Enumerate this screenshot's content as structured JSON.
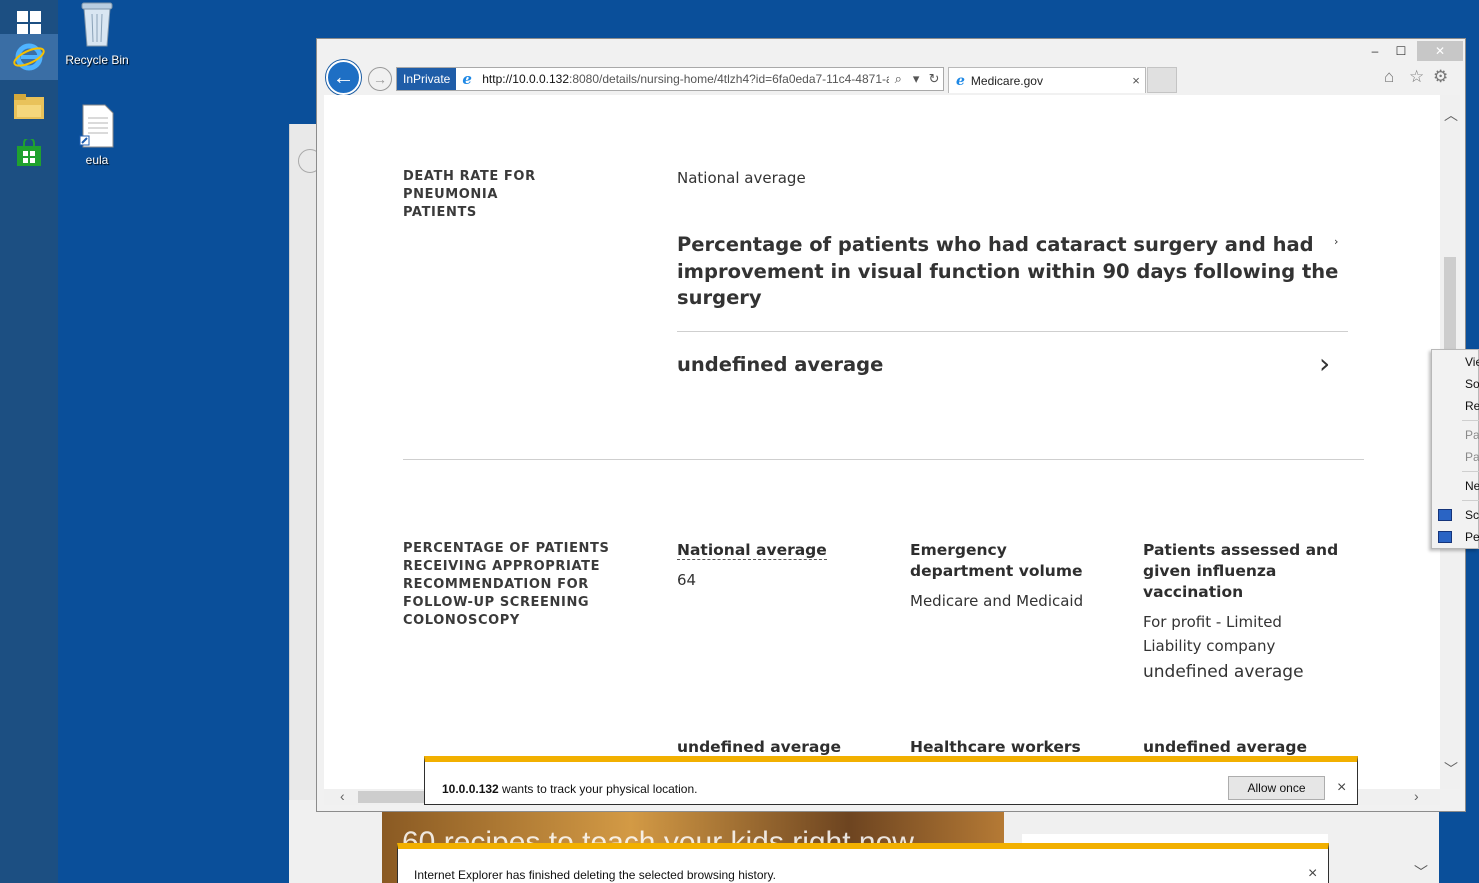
{
  "desktop": {
    "icons": [
      {
        "label": "Recycle Bin"
      },
      {
        "label": "eula"
      }
    ]
  },
  "browser": {
    "inprivate_label": "InPrivate",
    "url_host": "http://10.0.0.132",
    "url_rest": ":8080/details/nursing-home/4tlzh4?id=6fa0eda7-11c4-4871-a",
    "tab_title": "Medicare.gov",
    "window_controls": {
      "minimize": "–",
      "maximize": "☐",
      "close": "✕"
    }
  },
  "content": {
    "section1": {
      "label": "DEATH RATE FOR PNEUMONIA PATIENTS",
      "national_average": "National average",
      "heading": "Percentage of patients who had cataract surgery and had improvement in visual function within 90 days following the surgery",
      "average_link": "undefined average"
    },
    "section2": {
      "label": "PERCENTAGE OF PATIENTS RECEIVING APPROPRIATE RECOMMENDATION FOR FOLLOW-UP SCREENING COLONOSCOPY",
      "columns": [
        {
          "head": "National average",
          "value": "64"
        },
        {
          "head": "Emergency department volume",
          "value": "Medicare and Medicaid"
        },
        {
          "head": "Patients assessed and given influenza vaccination",
          "value": "For profit - Limited Liability company",
          "extra": "undefined average"
        }
      ],
      "bottom_row": [
        "undefined average",
        "Healthcare workers",
        "undefined average"
      ]
    }
  },
  "notifications": {
    "geo": {
      "host": "10.0.0.132",
      "message": " wants to track your physical location.",
      "allow_label": "Allow once"
    },
    "history": {
      "message": "Internet Explorer has finished deleting the selected browsing history."
    }
  },
  "background": {
    "headline": "60 recipes to teach your kids right now"
  },
  "context_menu": {
    "items": [
      "Vie",
      "So",
      "Re",
      "Pa",
      "Pa",
      "Ne",
      "Scr",
      "Pe"
    ]
  }
}
